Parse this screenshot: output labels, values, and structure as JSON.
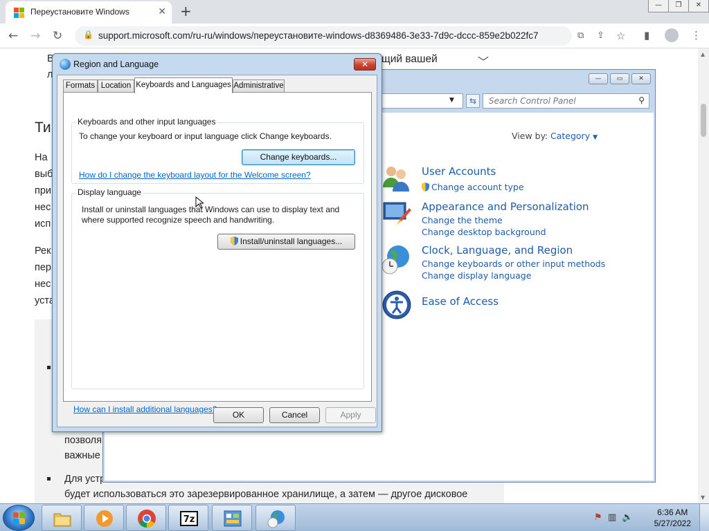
{
  "browser": {
    "tab_title": "Переустановите Windows",
    "url": "support.microsoft.com/ru-ru/windows/переустановите-windows-d8369486-3e33-7d9c-dccc-859e2b022fc7"
  },
  "page": {
    "top_line_tail": "щий вашей",
    "top_line_start": "В",
    "second_line_start": "л",
    "heading_start": "Ти",
    "para1": [
      "На",
      "выб",
      "при",
      "нес",
      "исп"
    ],
    "para2": [
      "Рек",
      "пер",
      "нес",
      "уста"
    ],
    "band_line1": "позволя",
    "band_line2": "важные",
    "bullet_line1": "Для устр",
    "bullet_line2": "будет использоваться это зарезервированное хранилище, а затем — другое дисковое"
  },
  "control_panel": {
    "search_placeholder": "Search Control Panel",
    "view_by_label": "View by:",
    "view_by_value": "Category",
    "categories": [
      {
        "title": "User Accounts",
        "links": [
          "Change account type"
        ]
      },
      {
        "title": "Appearance and Personalization",
        "links": [
          "Change the theme",
          "Change desktop background"
        ]
      },
      {
        "title": "Clock, Language, and Region",
        "links": [
          "Change keyboards or other input methods",
          "Change display language"
        ]
      },
      {
        "title": "Ease of Access",
        "links": []
      }
    ]
  },
  "dialog": {
    "title": "Region and Language",
    "tabs": [
      "Formats",
      "Location",
      "Keyboards and Languages",
      "Administrative"
    ],
    "active_tab": "Keyboards and Languages",
    "keyboards_group": {
      "legend": "Keyboards and other input languages",
      "description": "To change your keyboard or input language click Change keyboards.",
      "button": "Change keyboards...",
      "link": "How do I change the keyboard layout for the Welcome screen?"
    },
    "display_group": {
      "legend": "Display language",
      "description_line1": "Install or uninstall languages that Windows can use to display text and",
      "description_line2": "where supported recognize speech and handwriting.",
      "button": "Install/uninstall languages..."
    },
    "bottom_link": "How can I install additional languages?",
    "ok": "OK",
    "cancel": "Cancel",
    "apply": "Apply"
  },
  "taskbar": {
    "time": "6:36 AM",
    "date": "5/27/2022",
    "items": [
      "explorer",
      "media-player",
      "chrome",
      "7zip",
      "control-panel",
      "region-language"
    ]
  }
}
